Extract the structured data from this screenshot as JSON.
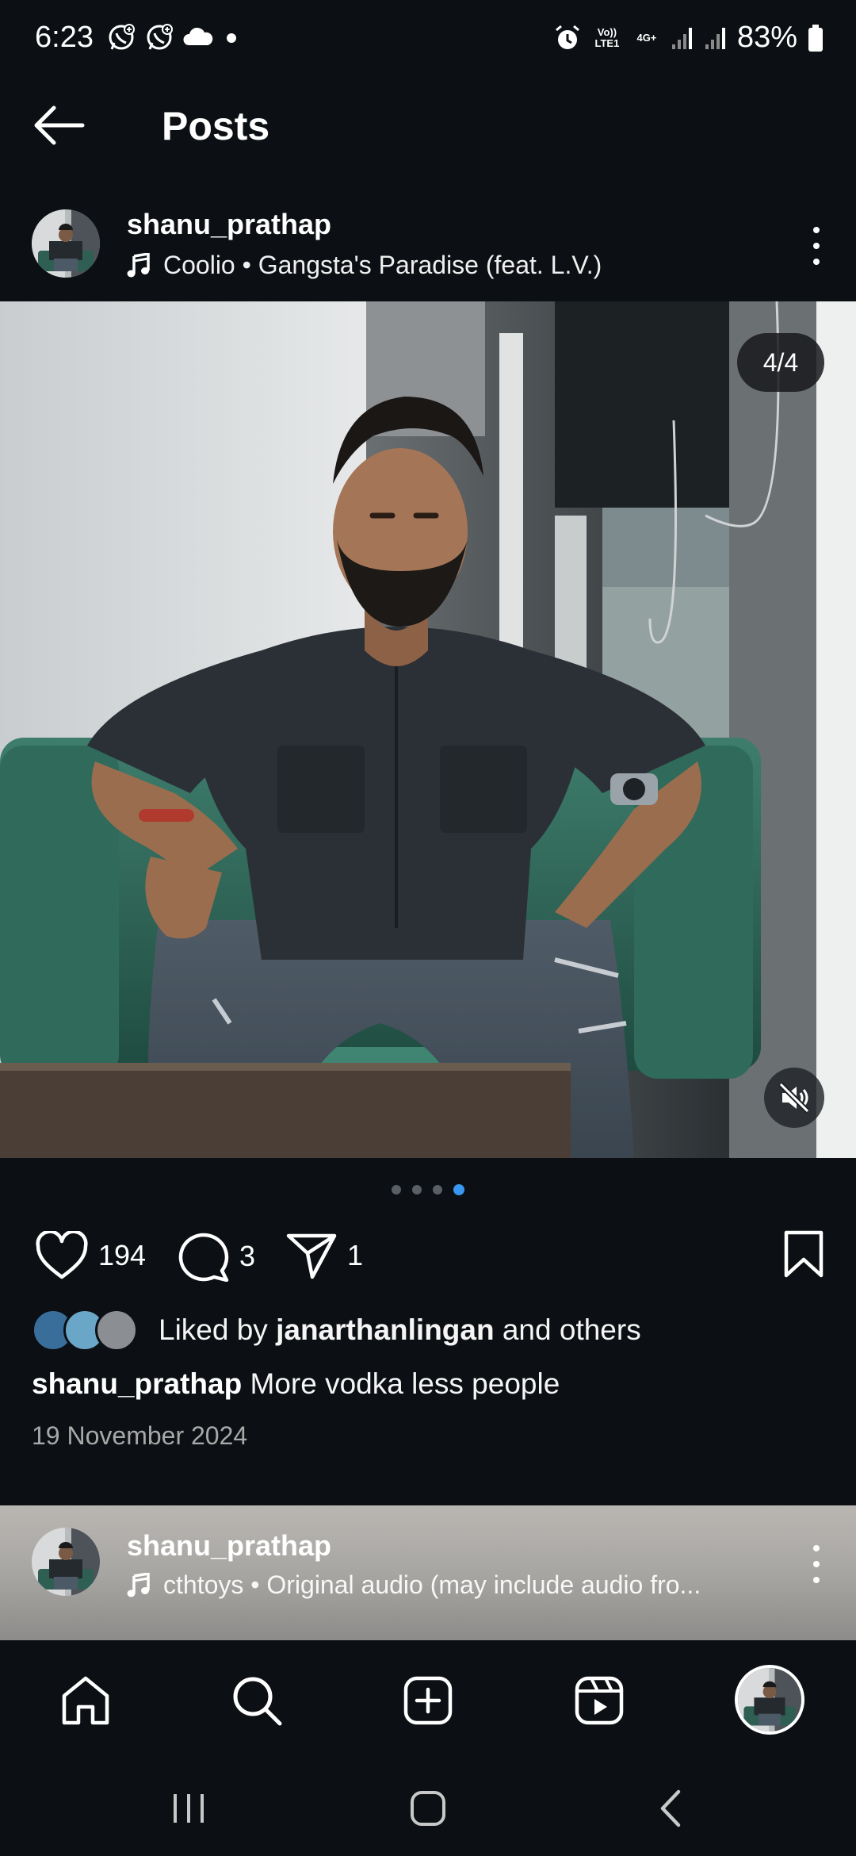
{
  "status_bar": {
    "time": "6:23",
    "battery": "83%",
    "network_volte": "Vo)) LTE1",
    "network_4g": "4G+",
    "left_icons": [
      "whatsapp-icon",
      "whatsapp-business-icon",
      "cloud-icon",
      "dot-icon"
    ],
    "right_icons": [
      "alarm-icon",
      "volte-icon",
      "4g-icon",
      "signal-icon",
      "signal-icon",
      "battery-icon"
    ]
  },
  "header": {
    "title": "Posts",
    "back_icon": "back-arrow-icon"
  },
  "post": {
    "username": "shanu_prathap",
    "audio": "Coolio • Gangsta's Paradise (feat. L.V.)",
    "counter": "4/4",
    "carousel_total": 4,
    "carousel_active": 4,
    "likes": "194",
    "comments": "3",
    "shares": "1",
    "liked_by_prefix": "Liked by",
    "liked_by_user": "janarthanlingan",
    "liked_by_suffix": "and others",
    "caption_user": "shanu_prathap",
    "caption_text": "More vodka less people",
    "date": "19 November 2024"
  },
  "next_post": {
    "username": "shanu_prathap",
    "audio": "cthtoys • Original audio (may include audio fro..."
  },
  "tabbar": {
    "items": [
      "home-icon",
      "search-icon",
      "create-icon",
      "reels-icon",
      "profile-avatar"
    ]
  },
  "colors": {
    "background": "#0c1014",
    "accent": "#3897f0",
    "secondary_text": "#a8a8a8"
  }
}
